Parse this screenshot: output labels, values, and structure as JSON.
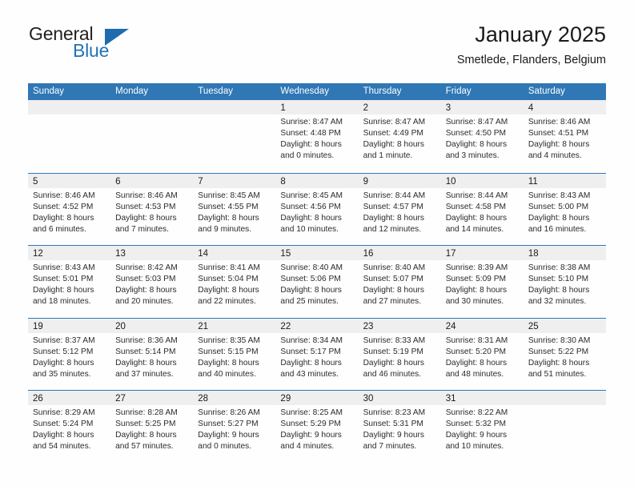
{
  "brand": {
    "name_part1": "General",
    "name_part2": "Blue",
    "triangle_color": "#1d6cb0",
    "blue_text_color": "#2272b6"
  },
  "header": {
    "title": "January 2025",
    "subtitle": "Smetlede, Flanders, Belgium"
  },
  "theme": {
    "header_row_bg": "#2f77b5",
    "header_row_text": "#ffffff",
    "day_band_bg": "#efefef",
    "row_divider": "#2f77b5",
    "page_bg": "#fefefe"
  },
  "weekdays": [
    "Sunday",
    "Monday",
    "Tuesday",
    "Wednesday",
    "Thursday",
    "Friday",
    "Saturday"
  ],
  "labels": {
    "sunrise_prefix": "Sunrise:",
    "sunset_prefix": "Sunset:",
    "daylight_prefix": "Daylight:"
  },
  "weeks": [
    [
      {
        "day": "",
        "empty": true
      },
      {
        "day": "",
        "empty": true
      },
      {
        "day": "",
        "empty": true
      },
      {
        "day": "1",
        "sunrise": "Sunrise: 8:47 AM",
        "sunset": "Sunset: 4:48 PM",
        "daylight_line1": "Daylight: 8 hours",
        "daylight_line2": "and 0 minutes."
      },
      {
        "day": "2",
        "sunrise": "Sunrise: 8:47 AM",
        "sunset": "Sunset: 4:49 PM",
        "daylight_line1": "Daylight: 8 hours",
        "daylight_line2": "and 1 minute."
      },
      {
        "day": "3",
        "sunrise": "Sunrise: 8:47 AM",
        "sunset": "Sunset: 4:50 PM",
        "daylight_line1": "Daylight: 8 hours",
        "daylight_line2": "and 3 minutes."
      },
      {
        "day": "4",
        "sunrise": "Sunrise: 8:46 AM",
        "sunset": "Sunset: 4:51 PM",
        "daylight_line1": "Daylight: 8 hours",
        "daylight_line2": "and 4 minutes."
      }
    ],
    [
      {
        "day": "5",
        "sunrise": "Sunrise: 8:46 AM",
        "sunset": "Sunset: 4:52 PM",
        "daylight_line1": "Daylight: 8 hours",
        "daylight_line2": "and 6 minutes."
      },
      {
        "day": "6",
        "sunrise": "Sunrise: 8:46 AM",
        "sunset": "Sunset: 4:53 PM",
        "daylight_line1": "Daylight: 8 hours",
        "daylight_line2": "and 7 minutes."
      },
      {
        "day": "7",
        "sunrise": "Sunrise: 8:45 AM",
        "sunset": "Sunset: 4:55 PM",
        "daylight_line1": "Daylight: 8 hours",
        "daylight_line2": "and 9 minutes."
      },
      {
        "day": "8",
        "sunrise": "Sunrise: 8:45 AM",
        "sunset": "Sunset: 4:56 PM",
        "daylight_line1": "Daylight: 8 hours",
        "daylight_line2": "and 10 minutes."
      },
      {
        "day": "9",
        "sunrise": "Sunrise: 8:44 AM",
        "sunset": "Sunset: 4:57 PM",
        "daylight_line1": "Daylight: 8 hours",
        "daylight_line2": "and 12 minutes."
      },
      {
        "day": "10",
        "sunrise": "Sunrise: 8:44 AM",
        "sunset": "Sunset: 4:58 PM",
        "daylight_line1": "Daylight: 8 hours",
        "daylight_line2": "and 14 minutes."
      },
      {
        "day": "11",
        "sunrise": "Sunrise: 8:43 AM",
        "sunset": "Sunset: 5:00 PM",
        "daylight_line1": "Daylight: 8 hours",
        "daylight_line2": "and 16 minutes."
      }
    ],
    [
      {
        "day": "12",
        "sunrise": "Sunrise: 8:43 AM",
        "sunset": "Sunset: 5:01 PM",
        "daylight_line1": "Daylight: 8 hours",
        "daylight_line2": "and 18 minutes."
      },
      {
        "day": "13",
        "sunrise": "Sunrise: 8:42 AM",
        "sunset": "Sunset: 5:03 PM",
        "daylight_line1": "Daylight: 8 hours",
        "daylight_line2": "and 20 minutes."
      },
      {
        "day": "14",
        "sunrise": "Sunrise: 8:41 AM",
        "sunset": "Sunset: 5:04 PM",
        "daylight_line1": "Daylight: 8 hours",
        "daylight_line2": "and 22 minutes."
      },
      {
        "day": "15",
        "sunrise": "Sunrise: 8:40 AM",
        "sunset": "Sunset: 5:06 PM",
        "daylight_line1": "Daylight: 8 hours",
        "daylight_line2": "and 25 minutes."
      },
      {
        "day": "16",
        "sunrise": "Sunrise: 8:40 AM",
        "sunset": "Sunset: 5:07 PM",
        "daylight_line1": "Daylight: 8 hours",
        "daylight_line2": "and 27 minutes."
      },
      {
        "day": "17",
        "sunrise": "Sunrise: 8:39 AM",
        "sunset": "Sunset: 5:09 PM",
        "daylight_line1": "Daylight: 8 hours",
        "daylight_line2": "and 30 minutes."
      },
      {
        "day": "18",
        "sunrise": "Sunrise: 8:38 AM",
        "sunset": "Sunset: 5:10 PM",
        "daylight_line1": "Daylight: 8 hours",
        "daylight_line2": "and 32 minutes."
      }
    ],
    [
      {
        "day": "19",
        "sunrise": "Sunrise: 8:37 AM",
        "sunset": "Sunset: 5:12 PM",
        "daylight_line1": "Daylight: 8 hours",
        "daylight_line2": "and 35 minutes."
      },
      {
        "day": "20",
        "sunrise": "Sunrise: 8:36 AM",
        "sunset": "Sunset: 5:14 PM",
        "daylight_line1": "Daylight: 8 hours",
        "daylight_line2": "and 37 minutes."
      },
      {
        "day": "21",
        "sunrise": "Sunrise: 8:35 AM",
        "sunset": "Sunset: 5:15 PM",
        "daylight_line1": "Daylight: 8 hours",
        "daylight_line2": "and 40 minutes."
      },
      {
        "day": "22",
        "sunrise": "Sunrise: 8:34 AM",
        "sunset": "Sunset: 5:17 PM",
        "daylight_line1": "Daylight: 8 hours",
        "daylight_line2": "and 43 minutes."
      },
      {
        "day": "23",
        "sunrise": "Sunrise: 8:33 AM",
        "sunset": "Sunset: 5:19 PM",
        "daylight_line1": "Daylight: 8 hours",
        "daylight_line2": "and 46 minutes."
      },
      {
        "day": "24",
        "sunrise": "Sunrise: 8:31 AM",
        "sunset": "Sunset: 5:20 PM",
        "daylight_line1": "Daylight: 8 hours",
        "daylight_line2": "and 48 minutes."
      },
      {
        "day": "25",
        "sunrise": "Sunrise: 8:30 AM",
        "sunset": "Sunset: 5:22 PM",
        "daylight_line1": "Daylight: 8 hours",
        "daylight_line2": "and 51 minutes."
      }
    ],
    [
      {
        "day": "26",
        "sunrise": "Sunrise: 8:29 AM",
        "sunset": "Sunset: 5:24 PM",
        "daylight_line1": "Daylight: 8 hours",
        "daylight_line2": "and 54 minutes."
      },
      {
        "day": "27",
        "sunrise": "Sunrise: 8:28 AM",
        "sunset": "Sunset: 5:25 PM",
        "daylight_line1": "Daylight: 8 hours",
        "daylight_line2": "and 57 minutes."
      },
      {
        "day": "28",
        "sunrise": "Sunrise: 8:26 AM",
        "sunset": "Sunset: 5:27 PM",
        "daylight_line1": "Daylight: 9 hours",
        "daylight_line2": "and 0 minutes."
      },
      {
        "day": "29",
        "sunrise": "Sunrise: 8:25 AM",
        "sunset": "Sunset: 5:29 PM",
        "daylight_line1": "Daylight: 9 hours",
        "daylight_line2": "and 4 minutes."
      },
      {
        "day": "30",
        "sunrise": "Sunrise: 8:23 AM",
        "sunset": "Sunset: 5:31 PM",
        "daylight_line1": "Daylight: 9 hours",
        "daylight_line2": "and 7 minutes."
      },
      {
        "day": "31",
        "sunrise": "Sunrise: 8:22 AM",
        "sunset": "Sunset: 5:32 PM",
        "daylight_line1": "Daylight: 9 hours",
        "daylight_line2": "and 10 minutes."
      },
      {
        "day": "",
        "empty": true
      }
    ]
  ]
}
